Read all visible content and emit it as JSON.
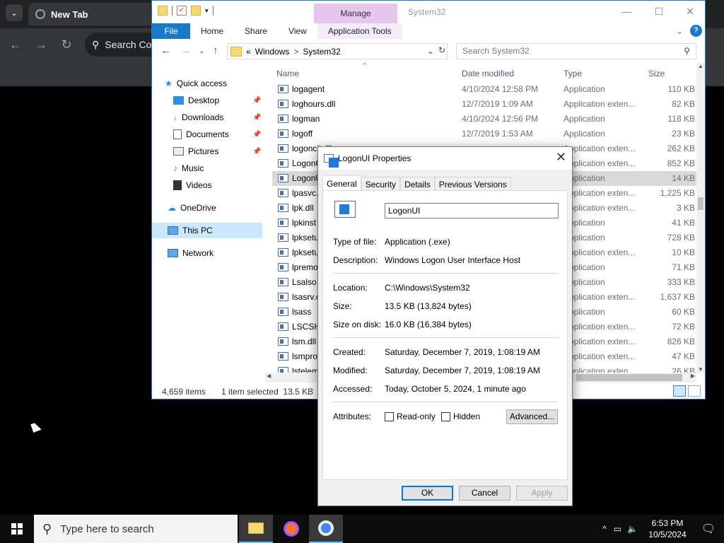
{
  "chrome": {
    "tab_title": "New Tab",
    "omnibox_text": "Search Co"
  },
  "explorer": {
    "manage_label": "Manage",
    "window_title": "System32",
    "ribbon_tabs": [
      "File",
      "Home",
      "Share",
      "View",
      "Application Tools"
    ],
    "breadcrumb": [
      "«",
      "Windows",
      ">",
      "System32"
    ],
    "search_placeholder": "Search System32",
    "nav": {
      "quick_access": "Quick access",
      "desktop": "Desktop",
      "downloads": "Downloads",
      "documents": "Documents",
      "pictures": "Pictures",
      "music": "Music",
      "videos": "Videos",
      "onedrive": "OneDrive",
      "this_pc": "This PC",
      "network": "Network"
    },
    "columns": {
      "name": "Name",
      "date": "Date modified",
      "type": "Type",
      "size": "Size"
    },
    "files": [
      {
        "name": "logagent",
        "date": "4/10/2024 12:58 PM",
        "type": "Application",
        "size": "110 KB"
      },
      {
        "name": "loghours.dll",
        "date": "12/7/2019 1:09 AM",
        "type": "Application exten...",
        "size": "82 KB"
      },
      {
        "name": "logman",
        "date": "4/10/2024 12:56 PM",
        "type": "Application",
        "size": "118 KB"
      },
      {
        "name": "logoff",
        "date": "12/7/2019 1:53 AM",
        "type": "Application",
        "size": "23 KB"
      },
      {
        "name": "logoncli.dll",
        "date": "",
        "type": "Application exten...",
        "size": "262 KB"
      },
      {
        "name": "LogonC",
        "date": "",
        "type": "Application exten...",
        "size": "852 KB"
      },
      {
        "name": "LogonU",
        "date": "",
        "type": "Application",
        "size": "14 KB"
      },
      {
        "name": "lpasvc.",
        "date": "",
        "type": "Application exten...",
        "size": "1,225 KB"
      },
      {
        "name": "lpk.dll",
        "date": "",
        "type": "Application exten...",
        "size": "3 KB"
      },
      {
        "name": "lpkinst",
        "date": "",
        "type": "Application",
        "size": "41 KB"
      },
      {
        "name": "lpksetu",
        "date": "",
        "type": "Application",
        "size": "728 KB"
      },
      {
        "name": "lpksetu",
        "date": "",
        "type": "Application exten...",
        "size": "10 KB"
      },
      {
        "name": "lpremo",
        "date": "",
        "type": "Application",
        "size": "71 KB"
      },
      {
        "name": "Lsalso",
        "date": "",
        "type": "Application",
        "size": "333 KB"
      },
      {
        "name": "lsasrv.c",
        "date": "",
        "type": "Application exten...",
        "size": "1,637 KB"
      },
      {
        "name": "lsass",
        "date": "",
        "type": "Application",
        "size": "60 KB"
      },
      {
        "name": "LSCSH",
        "date": "",
        "type": "Application exten...",
        "size": "72 KB"
      },
      {
        "name": "lsm.dll",
        "date": "",
        "type": "Application exten...",
        "size": "826 KB"
      },
      {
        "name": "lsmpro",
        "date": "",
        "type": "Application exten...",
        "size": "47 KB"
      },
      {
        "name": "lstelem",
        "date": "",
        "type": "Application exten...",
        "size": "26 KB"
      }
    ],
    "status_items": "4,659 items",
    "status_selected": "1 item selected  13.5 KB"
  },
  "dialog": {
    "title": "LogonUI Properties",
    "tabs": [
      "General",
      "Security",
      "Details",
      "Previous Versions"
    ],
    "name_value": "LogonUI",
    "type_label": "Type of file:",
    "type_value": "Application (.exe)",
    "desc_label": "Description:",
    "desc_value": "Windows Logon User Interface Host",
    "loc_label": "Location:",
    "loc_value": "C:\\Windows\\System32",
    "size_label": "Size:",
    "size_value": "13.5 KB (13,824 bytes)",
    "disk_label": "Size on disk:",
    "disk_value": "16.0 KB (16,384 bytes)",
    "created_label": "Created:",
    "created_value": "Saturday, December 7, 2019, 1:08:19 AM",
    "modified_label": "Modified:",
    "modified_value": "Saturday, December 7, 2019, 1:08:19 AM",
    "accessed_label": "Accessed:",
    "accessed_value": "Today, October 5, 2024, 1 minute ago",
    "attr_label": "Attributes:",
    "readonly_label": "Read-only",
    "hidden_label": "Hidden",
    "advanced_label": "Advanced...",
    "ok_label": "OK",
    "cancel_label": "Cancel",
    "apply_label": "Apply"
  },
  "taskbar": {
    "search_placeholder": "Type here to search",
    "time": "6:53 PM",
    "date": "10/5/2024"
  }
}
